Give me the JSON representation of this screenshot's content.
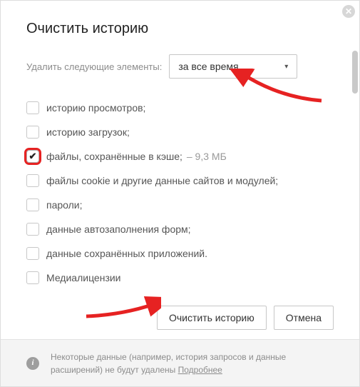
{
  "dialog": {
    "title": "Очистить историю",
    "range_label": "Удалить следующие элементы:",
    "range_value": "за все время",
    "options": [
      {
        "label": "историю просмотров;",
        "checked": false
      },
      {
        "label": "историю загрузок;",
        "checked": false
      },
      {
        "label": "файлы, сохранённые в кэше;",
        "suffix": "– 9,3 МБ",
        "checked": true,
        "highlight": true
      },
      {
        "label": "файлы cookie и другие данные сайтов и модулей;",
        "checked": false
      },
      {
        "label": "пароли;",
        "checked": false
      },
      {
        "label": "данные автозаполнения форм;",
        "checked": false
      },
      {
        "label": "данные сохранённых приложений.",
        "checked": false
      },
      {
        "label": "Медиалицензии",
        "checked": false
      }
    ],
    "buttons": {
      "confirm": "Очистить историю",
      "cancel": "Отмена"
    },
    "footer": {
      "text": "Некоторые данные (например, история запросов и данные расширений) не будут удалены ",
      "more": "Подробнее"
    }
  },
  "annotations": {
    "arrow_color": "#e62222"
  }
}
